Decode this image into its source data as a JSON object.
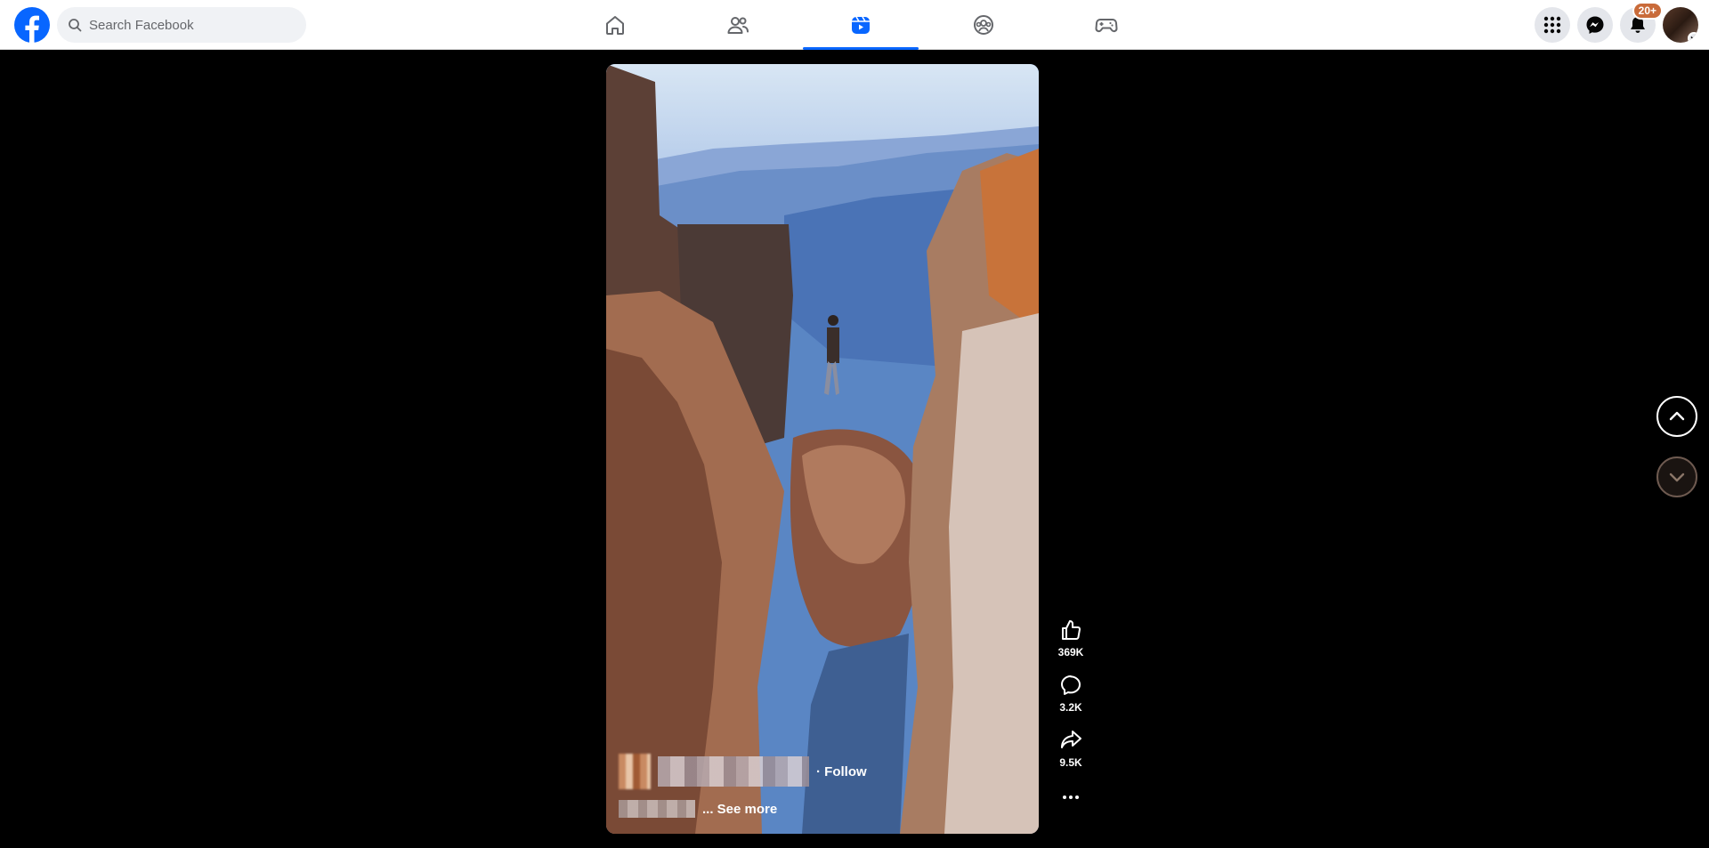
{
  "search": {
    "placeholder": "Search Facebook"
  },
  "nav": {
    "items": [
      {
        "name": "Home",
        "icon": "home-icon",
        "active": false
      },
      {
        "name": "Friends",
        "icon": "friends-icon",
        "active": false
      },
      {
        "name": "Reels",
        "icon": "reels-icon",
        "active": true
      },
      {
        "name": "Groups",
        "icon": "groups-icon",
        "active": false
      },
      {
        "name": "Gaming",
        "icon": "gaming-icon",
        "active": false
      }
    ]
  },
  "header_right": {
    "menu_icon": "grid-menu-icon",
    "messenger_icon": "messenger-icon",
    "notifications_icon": "bell-icon",
    "notifications_badge": "20+"
  },
  "reel": {
    "follow_label": "· Follow",
    "see_more_label": "... See more",
    "actions": {
      "likes": "369K",
      "comments": "3.2K",
      "shares": "9.5K"
    }
  },
  "colors": {
    "brand": "#0866ff",
    "background": "#000000",
    "badge": "#c96b3a"
  }
}
